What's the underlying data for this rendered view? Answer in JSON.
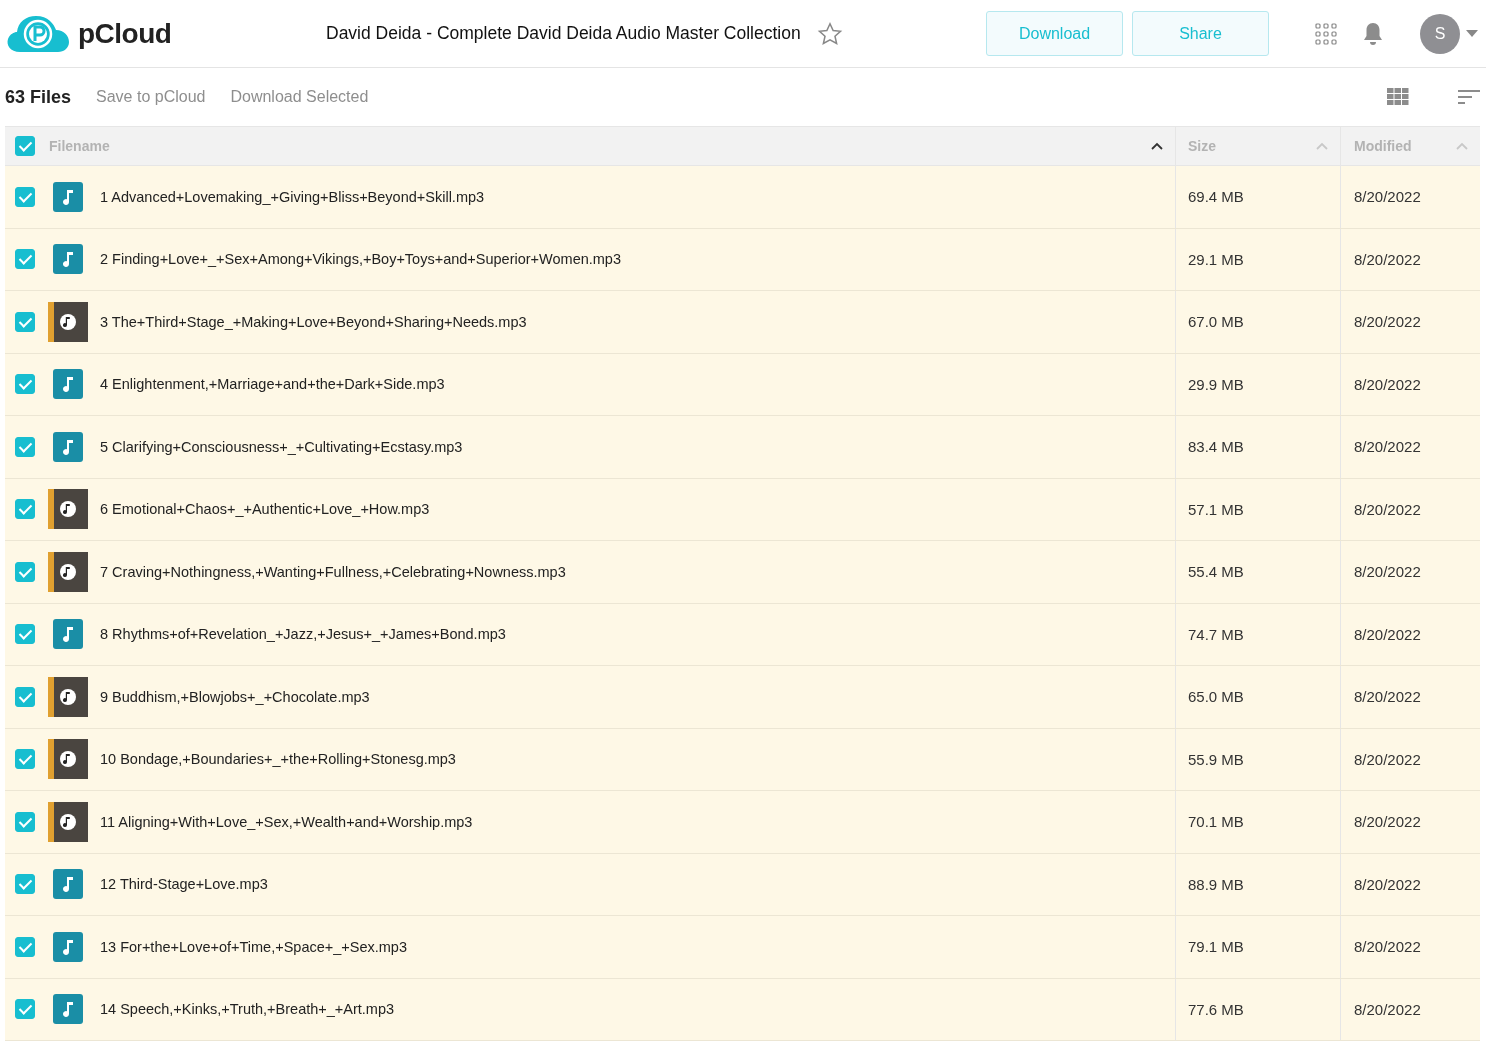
{
  "header": {
    "logo_text": "pCloud",
    "title": "David Deida - Complete David Deida Audio Master Collection",
    "starred": false,
    "buttons": [
      "Download",
      "Share"
    ],
    "avatar_letter": "S"
  },
  "toolbar": {
    "count": "63 Files",
    "actions": [
      "Save to pCloud",
      "Download Selected"
    ]
  },
  "table": {
    "select_all_checked": true,
    "columns": [
      {
        "label": "Filename",
        "sorted": true
      },
      {
        "label": "Size",
        "sorted": false
      },
      {
        "label": "Modified",
        "sorted": false
      }
    ],
    "rows": [
      {
        "kind": "audio",
        "name": "1 Advanced+Lovemaking_+Giving+Bliss+Beyond+Skill.mp3",
        "size": "69.4 MB",
        "modified": "8/20/2022",
        "checked": true,
        "selected": true
      },
      {
        "kind": "audio",
        "name": "2 Finding+Love+_+Sex+Among+Vikings,+Boy+Toys+and+Superior+Women.mp3",
        "size": "29.1 MB",
        "modified": "8/20/2022",
        "checked": true,
        "selected": true
      },
      {
        "kind": "thumbnail",
        "name": "3 The+Third+Stage_+Making+Love+Beyond+Sharing+Needs.mp3",
        "size": "67.0 MB",
        "modified": "8/20/2022",
        "checked": true,
        "selected": true
      },
      {
        "kind": "audio",
        "name": "4 Enlightenment,+Marriage+and+the+Dark+Side.mp3",
        "size": "29.9 MB",
        "modified": "8/20/2022",
        "checked": true,
        "selected": true
      },
      {
        "kind": "audio",
        "name": "5 Clarifying+Consciousness+_+Cultivating+Ecstasy.mp3",
        "size": "83.4 MB",
        "modified": "8/20/2022",
        "checked": true,
        "selected": true
      },
      {
        "kind": "thumbnail",
        "name": "6 Emotional+Chaos+_+Authentic+Love_+How.mp3",
        "size": "57.1 MB",
        "modified": "8/20/2022",
        "checked": true,
        "selected": true
      },
      {
        "kind": "thumbnail",
        "name": "7 Craving+Nothingness,+Wanting+Fullness,+Celebrating+Nowness.mp3",
        "size": "55.4 MB",
        "modified": "8/20/2022",
        "checked": true,
        "selected": true
      },
      {
        "kind": "audio",
        "name": "8 Rhythms+of+Revelation_+Jazz,+Jesus+_+James+Bond.mp3",
        "size": "74.7 MB",
        "modified": "8/20/2022",
        "checked": true,
        "selected": true
      },
      {
        "kind": "thumbnail",
        "name": "9 Buddhism,+Blowjobs+_+Chocolate.mp3",
        "size": "65.0 MB",
        "modified": "8/20/2022",
        "checked": true,
        "selected": true
      },
      {
        "kind": "thumbnail",
        "name": "10 Bondage,+Boundaries+_+the+Rolling+Stonesg.mp3",
        "size": "55.9 MB",
        "modified": "8/20/2022",
        "checked": true,
        "selected": true
      },
      {
        "kind": "thumbnail",
        "name": "11 Aligning+With+Love_+Sex,+Wealth+and+Worship.mp3",
        "size": "70.1 MB",
        "modified": "8/20/2022",
        "checked": true,
        "selected": true
      },
      {
        "kind": "audio",
        "name": "12 Third-Stage+Love.mp3",
        "size": "88.9 MB",
        "modified": "8/20/2022",
        "checked": true,
        "selected": true
      },
      {
        "kind": "audio",
        "name": "13 For+the+Love+of+Time,+Space+_+Sex.mp3",
        "size": "79.1 MB",
        "modified": "8/20/2022",
        "checked": true,
        "selected": true
      },
      {
        "kind": "audio",
        "name": "14 Speech,+Kinks,+Truth,+Breath+_+Art.mp3",
        "size": "77.6 MB",
        "modified": "8/20/2022",
        "checked": true,
        "selected": true
      }
    ]
  }
}
